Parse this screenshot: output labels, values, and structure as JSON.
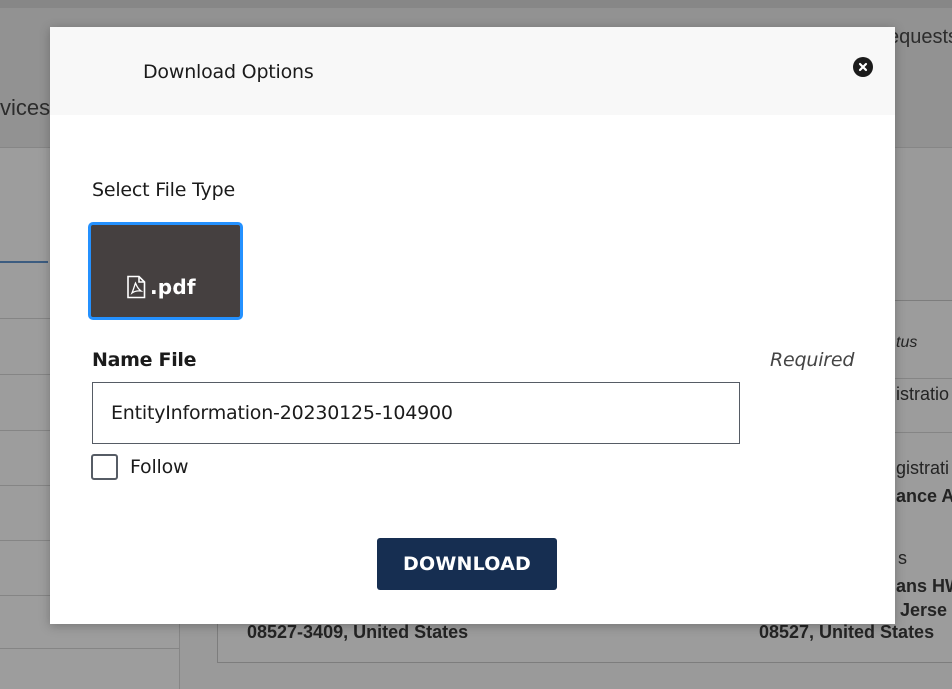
{
  "background": {
    "nav_left": "vices",
    "nav_right": "equests",
    "panel": {
      "col_right_italic_1": "tus",
      "col_right_line_1": "istratio",
      "col_right_line_2": "gistrati",
      "col_right_line_3": "ance A",
      "col_right_line_4": "s",
      "col_right_line_5": "ans HW",
      "col_right_line_6": "Jerse",
      "address_left": "08527-3409, United States",
      "address_right": "08527, United States"
    }
  },
  "modal": {
    "title": "Download Options",
    "close_icon": "close-circle-icon",
    "file_type_label": "Select File Type",
    "file_types": [
      {
        "label": ".pdf",
        "icon": "pdf-file-icon",
        "selected": true
      }
    ],
    "name_label": "Name File",
    "required_label": "Required",
    "name_value": "EntityInformation-20230125-104900",
    "follow_label": "Follow",
    "follow_checked": false,
    "download_label": "DOWNLOAD"
  },
  "colors": {
    "primary_button": "#162e51",
    "tile_background": "#454040",
    "tile_focus": "#2491ff"
  }
}
